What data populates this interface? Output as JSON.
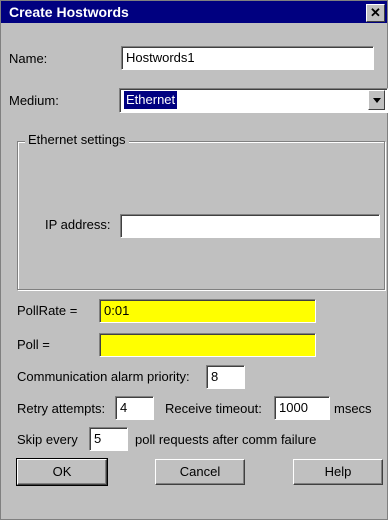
{
  "window": {
    "title": "Create Hostwords",
    "close_glyph": "✕"
  },
  "name": {
    "label": "Name:",
    "value": "Hostwords1"
  },
  "medium": {
    "label": "Medium:",
    "value": "Ethernet"
  },
  "ethernet": {
    "group_title": "Ethernet settings",
    "ip_label": "IP address:",
    "ip_value": ""
  },
  "pollrate": {
    "label": "PollRate =",
    "value": "0:01"
  },
  "poll": {
    "label": "Poll =",
    "value": ""
  },
  "comm_alarm": {
    "label": "Communication alarm priority:",
    "value": "8"
  },
  "retry": {
    "label": "Retry attempts:",
    "value": "4"
  },
  "receive_timeout": {
    "label": "Receive timeout:",
    "value": "1000",
    "unit": "msecs"
  },
  "skip": {
    "label_before": "Skip every",
    "value": "5",
    "label_after": "poll requests after comm failure"
  },
  "buttons": {
    "ok": "OK",
    "cancel": "Cancel",
    "help": "Help"
  },
  "colors": {
    "titlebar": "#000080",
    "dialog": "#c0c0c0",
    "highlight_field": "#ffff00"
  }
}
